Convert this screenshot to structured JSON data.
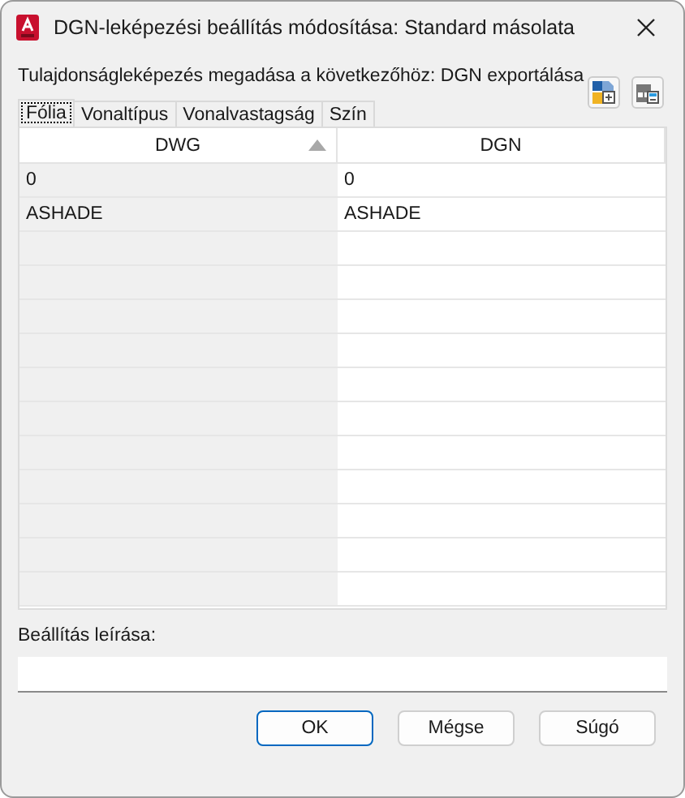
{
  "window": {
    "title": "DGN-leképezési beállítás módosítása: Standard másolata"
  },
  "instruction": "Tulajdonságleképezés megadása a következőhöz: DGN exportálása",
  "tabs": [
    {
      "label": "Fólia",
      "selected": true
    },
    {
      "label": "Vonaltípus",
      "selected": false
    },
    {
      "label": "Vonalvastagság",
      "selected": false
    },
    {
      "label": "Szín",
      "selected": false
    }
  ],
  "table": {
    "columns": [
      {
        "label": "DWG",
        "sorted": true
      },
      {
        "label": "DGN",
        "sorted": false
      }
    ],
    "rows": [
      [
        "0",
        "0"
      ],
      [
        "ASHADE",
        "ASHADE"
      ]
    ]
  },
  "description": {
    "label": "Beállítás leírása:"
  },
  "buttons": [
    {
      "label": "OK",
      "default": true
    },
    {
      "label": "Mégse",
      "default": false
    },
    {
      "label": "Súgó",
      "default": false
    }
  ]
}
